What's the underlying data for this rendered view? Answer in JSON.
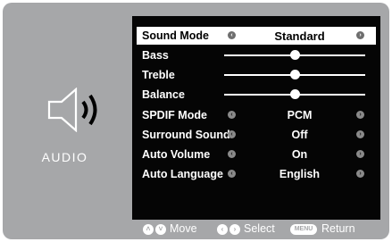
{
  "side_panel": {
    "icon": "speaker-icon",
    "label": "AUDIO"
  },
  "menu": {
    "rows": [
      {
        "label": "Sound Mode",
        "type": "select",
        "value": "Standard",
        "selected": true
      },
      {
        "label": "Bass",
        "type": "slider",
        "level": 0.5
      },
      {
        "label": "Treble",
        "type": "slider",
        "level": 0.5
      },
      {
        "label": "Balance",
        "type": "slider",
        "level": 0.5
      },
      {
        "label": "SPDIF Mode",
        "type": "select",
        "value": "PCM"
      },
      {
        "label": "Surround Sound",
        "type": "select",
        "value": "Off"
      },
      {
        "label": "Auto Volume",
        "type": "select",
        "value": "On"
      },
      {
        "label": "Auto Language",
        "type": "select",
        "value": "English"
      }
    ]
  },
  "footer": {
    "move_label": "Move",
    "select_label": "Select",
    "menu_key": "MENU",
    "return_label": "Return"
  },
  "colors": {
    "frame": "#a6a7a9",
    "panel": "#050505",
    "highlight": "#ffffff"
  }
}
